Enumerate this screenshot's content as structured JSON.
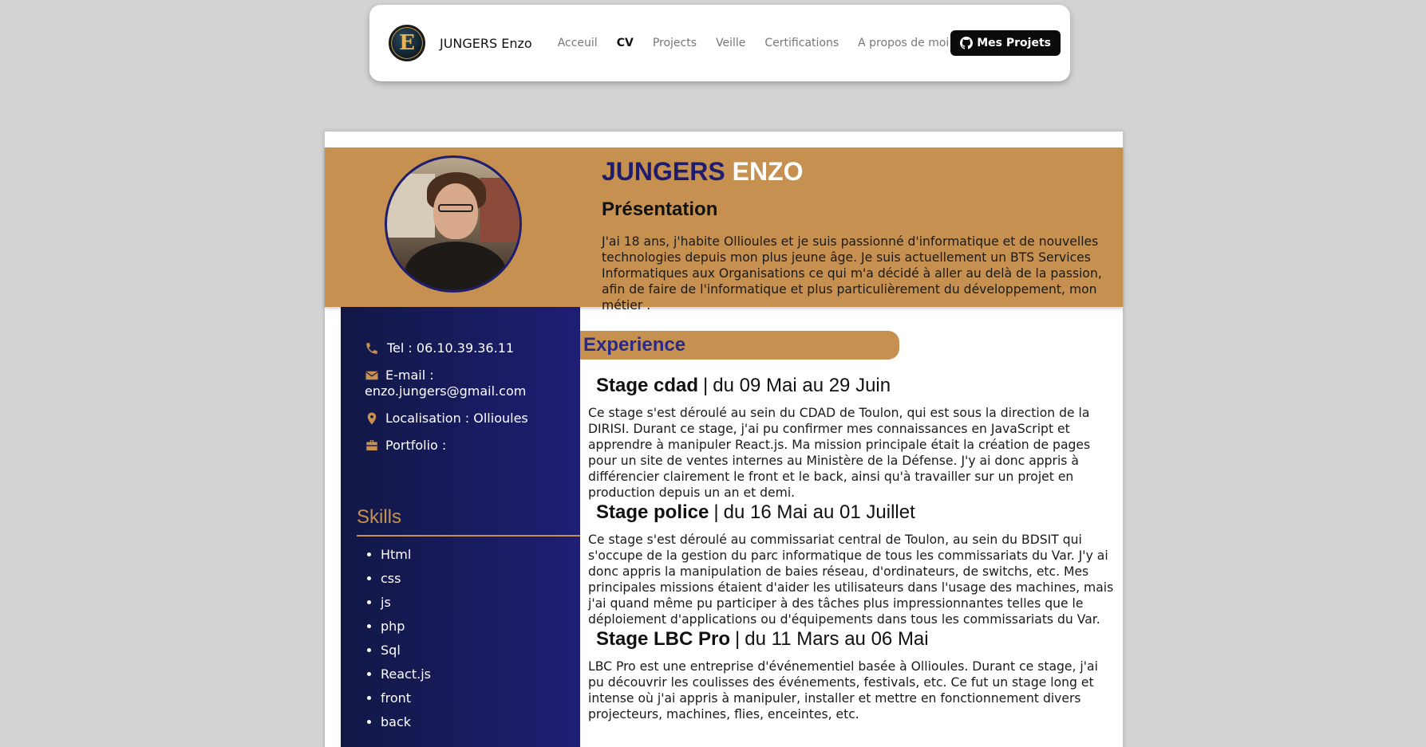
{
  "nav": {
    "logo_letter": "E",
    "brand": "JUNGERS Enzo",
    "links": [
      "Acceuil",
      "CV",
      "Projects",
      "Veille",
      "Certifications",
      "A propos de moi"
    ],
    "active": "CV",
    "github_button": "Mes Projets"
  },
  "header": {
    "first_name": "JUNGERS",
    "last_name": "ENZO",
    "presentation_title": "Présentation",
    "presentation_text": "J'ai 18 ans, j'habite Ollioules et je suis passionné d'informatique et de nouvelles technologies depuis mon plus jeune âge. Je suis actuellement un BTS Services Informatiques aux Organisations ce qui m'a décidé à aller au delà de la passion, afin de faire de l'informatique et plus particulièrement du développement, mon métier ."
  },
  "contact": {
    "tel": "Tel : 06.10.39.36.11",
    "email_label": "E-mail :",
    "email": "enzo.jungers@gmail.com",
    "location": "Localisation : Ollioules",
    "portfolio": "Portfolio :"
  },
  "skills": {
    "title": "Skills",
    "items": [
      "Html",
      "css",
      "js",
      "php",
      "Sql",
      "React.js",
      "front",
      "back"
    ]
  },
  "experience": {
    "title": "Experience",
    "items": [
      {
        "name": "Stage cdad",
        "dates": "du 09 Mai au 29 Juin",
        "description": "Ce stage s'est déroulé au sein du CDAD de Toulon, qui est sous la direction de la DIRISI. Durant ce stage, j'ai pu confirmer mes connaissances en JavaScript et apprendre à manipuler React.js. Ma mission principale était la création de pages pour un site de ventes internes au Ministère de la Défense. J'y ai donc appris à différencier clairement le front et le back, ainsi qu'à travailler sur un projet en production depuis un an et demi."
      },
      {
        "name": "Stage police",
        "dates": "du 16 Mai au 01 Juillet",
        "description": "Ce stage s'est déroulé au commissariat central de Toulon, au sein du BDSIT qui s'occupe de la gestion du parc informatique de tous les commissariats du Var. J'y ai donc appris la manipulation de baies réseau, d'ordinateurs, de switchs, etc. Mes principales missions étaient d'aider les utilisateurs dans l'usage des machines, mais j'ai quand même pu participer à des tâches plus impressionnantes telles que le déploiement d'applications ou d'équipements dans tous les commissariats du Var."
      },
      {
        "name": "Stage LBC Pro",
        "dates": "du 11 Mars au 06 Mai",
        "description": "LBC Pro est une entreprise d'événementiel basée à Ollioules. Durant ce stage, j'ai pu découvrir les coulisses des événements, festivals, etc. Ce fut un stage long et intense où j'ai appris à manipuler, installer et mettre en fonctionnement divers projecteurs, machines, flies, enceintes, etc."
      }
    ]
  },
  "colors": {
    "gold": "#c69150",
    "navy": "#1f1d6b",
    "sidebar": "#1e1e74"
  }
}
